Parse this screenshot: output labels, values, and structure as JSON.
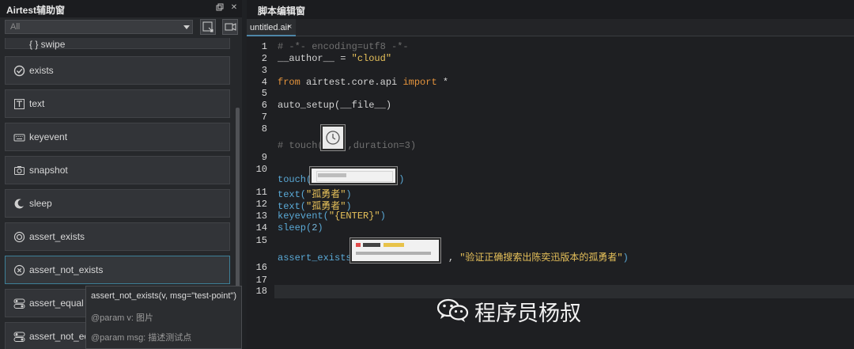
{
  "left_panel": {
    "title": "Airtest辅助窗",
    "filter": {
      "value": "All"
    },
    "items": [
      {
        "label": "{ } swipe",
        "icon": "swipe-icon"
      },
      {
        "label": "exists",
        "icon": "check-circle-icon"
      },
      {
        "label": "text",
        "icon": "text-box-icon"
      },
      {
        "label": "keyevent",
        "icon": "keyboard-icon"
      },
      {
        "label": "snapshot",
        "icon": "camera-icon"
      },
      {
        "label": "sleep",
        "icon": "moon-icon"
      },
      {
        "label": "assert_exists",
        "icon": "target-icon"
      },
      {
        "label": "assert_not_exists",
        "icon": "target-x-icon"
      },
      {
        "label": "assert_equal",
        "icon": "toggle-icon"
      },
      {
        "label": "assert_not_equal",
        "icon": "toggle-icon"
      }
    ],
    "tooltip": {
      "signature": "assert_not_exists(v, msg=\"test-point\")",
      "param_v": "@param v: 图片",
      "param_msg": "@param msg: 描述测试点"
    }
  },
  "editor": {
    "title": "脚本编辑窗",
    "tab": {
      "label": "untitled.air",
      "close": "×"
    },
    "line_numbers": [
      "1",
      "2",
      "3",
      "4",
      "5",
      "6",
      "7",
      "8",
      "9",
      "10",
      "11",
      "12",
      "13",
      "14",
      "15",
      "16",
      "17",
      "18"
    ],
    "code": {
      "l1": "# -*- encoding=utf8 -*-",
      "l2a": "__author__ = ",
      "l2b": "\"cloud\"",
      "l4a": "from",
      "l4b": " airtest.core.api ",
      "l4c": "import",
      "l4d": " *",
      "l6": "auto_setup(__file__)",
      "l8a": "# touch(",
      "l8b": ",duration=3)",
      "l10a": "touch(",
      "l10b": ")",
      "l11a": "text(",
      "l11b": "\"孤勇者\"",
      "l11c": ")",
      "l12a": "text(",
      "l12b": "\"孤勇者\"",
      "l12c": ")",
      "l13a": "keyevent(",
      "l13b": "\"{ENTER}\"",
      "l13c": ")",
      "l14a": "sleep(",
      "l14b": "2",
      "l14c": ")",
      "l15a": "assert_exists(",
      "l15b": ", ",
      "l15c": "\"验证正确搜索出陈奕迅版本的孤勇者\"",
      "l15d": ")"
    }
  },
  "watermark": {
    "text": "程序员杨叔"
  }
}
